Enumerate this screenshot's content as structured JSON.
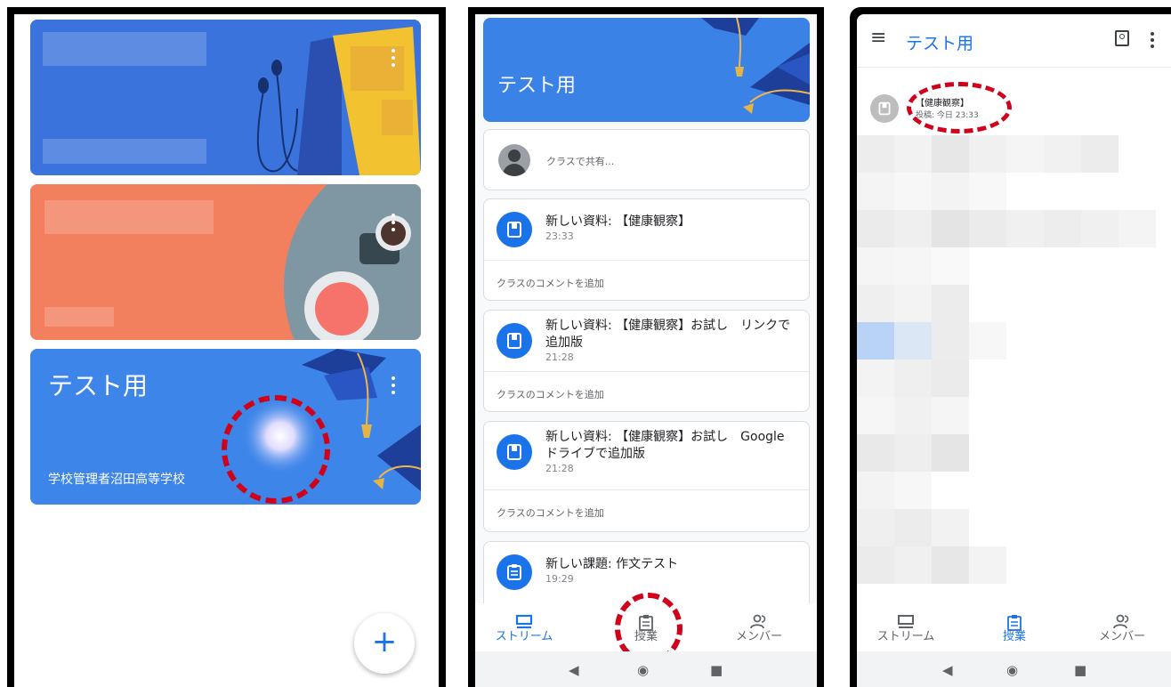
{
  "colors": {
    "accent": "#1a73e8",
    "card_blue": "#3b7ae0",
    "card_orange": "#f47c5c",
    "card_test": "#3f86e8",
    "highlight": "#d0021b"
  },
  "panel1": {
    "test_card": {
      "title": "テスト用",
      "subtitle": "学校管理者沼田高等学校"
    },
    "fab_icon": "plus-icon",
    "fab_label": "+"
  },
  "panel2": {
    "class_title": "テスト用",
    "share_placeholder": "クラスで共有...",
    "posts": [
      {
        "title": "新しい資料: 【健康観察】",
        "time": "23:33",
        "icon": "material-icon"
      },
      {
        "title": "新しい資料: 【健康観察】お試し　リンクで追加版",
        "time": "21:28",
        "icon": "material-icon"
      },
      {
        "title": "新しい資料: 【健康観察】お試し　Google ドライブで追加版",
        "time": "21:28",
        "icon": "material-icon"
      },
      {
        "title": "新しい課題: 作文テスト",
        "time": "19:29",
        "icon": "assignment-icon"
      }
    ],
    "comment_label": "クラスのコメントを追加",
    "nav": {
      "stream": "ストリーム",
      "classwork": "授業",
      "members": "メンバー",
      "active": "stream"
    }
  },
  "panel3": {
    "title": "テスト用",
    "material": {
      "title": "【健康観察】",
      "meta": "投稿: 今日 23:33"
    },
    "nav": {
      "stream": "ストリーム",
      "classwork": "授業",
      "members": "メンバー",
      "active": "classwork"
    }
  },
  "system_nav": {
    "back": "◀",
    "home": "◉",
    "recents": "■"
  }
}
